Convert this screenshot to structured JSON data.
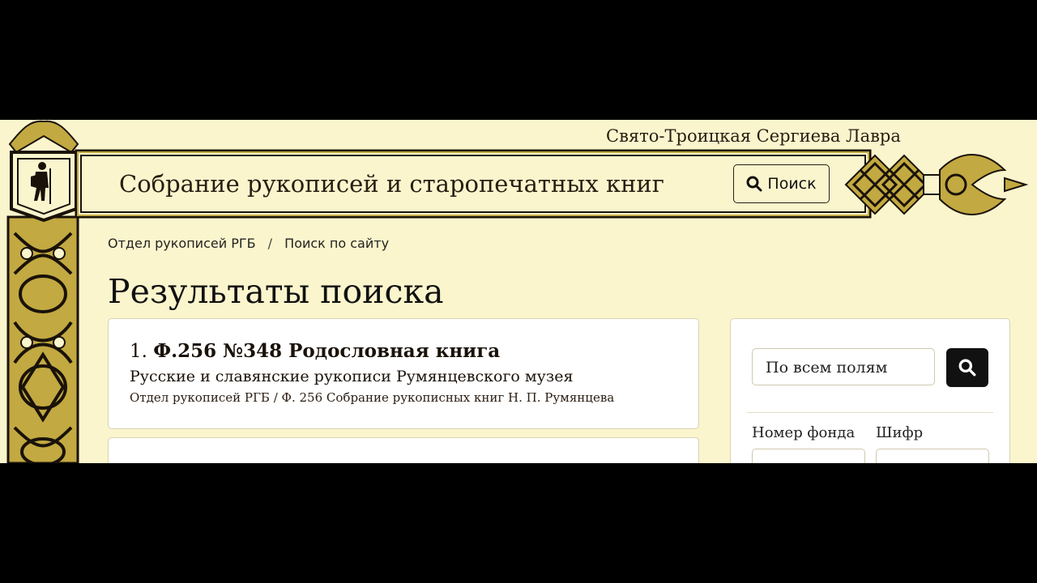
{
  "header": {
    "lavra_title": "Свято-Троицкая Сергиева Лавра",
    "site_title": "Собрание рукописей и старопечатных книг",
    "search_button_label": "Поиск"
  },
  "breadcrumb": {
    "items": [
      "Отдел рукописей РГБ",
      "Поиск по сайту"
    ],
    "separator": "/"
  },
  "page": {
    "title": "Результаты поиска"
  },
  "results": [
    {
      "number": "1.",
      "title": "Ф.256 №348 Родословная книга",
      "subtitle": "Русские и славянские рукописи Румянцевского музея",
      "meta": "Отдел рукописей РГБ / Ф. 256 Собрание рукописных книг Н. П. Румянцева"
    }
  ],
  "sidebar": {
    "search_value": "По всем полям",
    "fund_label": "Номер фонда",
    "cipher_label": "Шифр"
  },
  "icons": {
    "search": "search-icon",
    "pilgrim_logo": "pilgrim-logo-icon"
  },
  "colors": {
    "background": "#fbf5cd",
    "ornament_gold": "#c2a941",
    "ornament_dark": "#1a1209",
    "button_dark": "#111111"
  }
}
